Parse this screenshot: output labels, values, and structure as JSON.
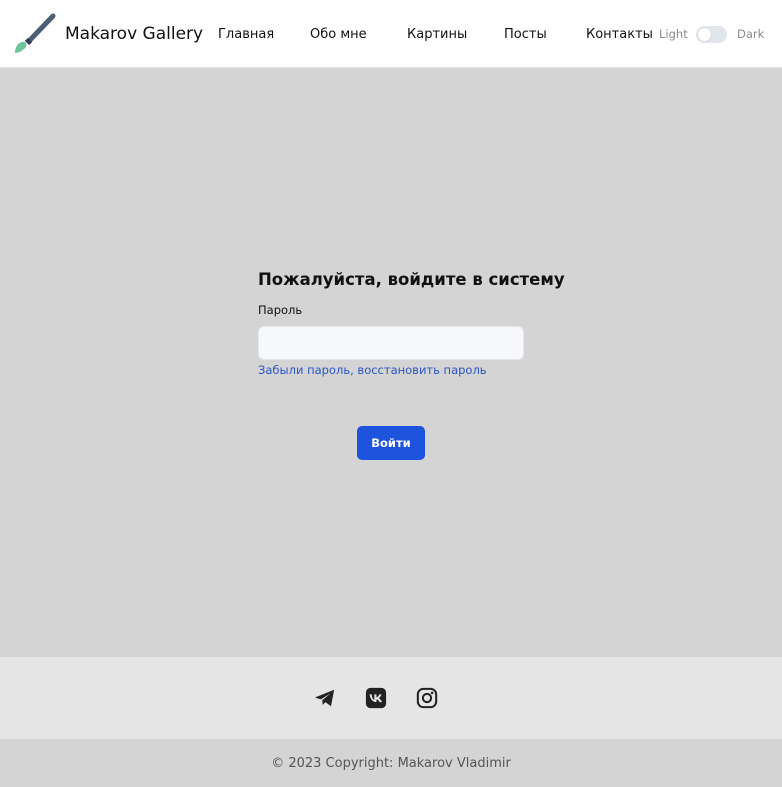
{
  "header": {
    "brand": "Makarov Gallery",
    "logo_icon": "paintbrush-icon",
    "nav": [
      {
        "label": "Главная"
      },
      {
        "label": "Обо мне"
      },
      {
        "label": "Картины"
      },
      {
        "label": "Посты"
      },
      {
        "label": "Контакты"
      }
    ],
    "theme": {
      "light_label": "Light",
      "dark_label": "Dark",
      "mode": "light"
    }
  },
  "login": {
    "title": "Пожалуйста, войдите в систему",
    "password_label": "Пароль",
    "password_value": "",
    "forgot_link": "Забыли пароль, восстановить пароль",
    "submit_label": "Войти"
  },
  "footer": {
    "social": [
      {
        "icon": "telegram-icon"
      },
      {
        "icon": "vk-icon"
      },
      {
        "icon": "instagram-icon"
      }
    ],
    "copyright": "© 2023 Copyright: Makarov Vladimir"
  },
  "colors": {
    "accent": "#1d53dd",
    "link": "#2b55c7",
    "page_bg": "#d4d4d4",
    "header_bg": "#ffffff",
    "social_bar_bg": "#e5e5e5"
  }
}
